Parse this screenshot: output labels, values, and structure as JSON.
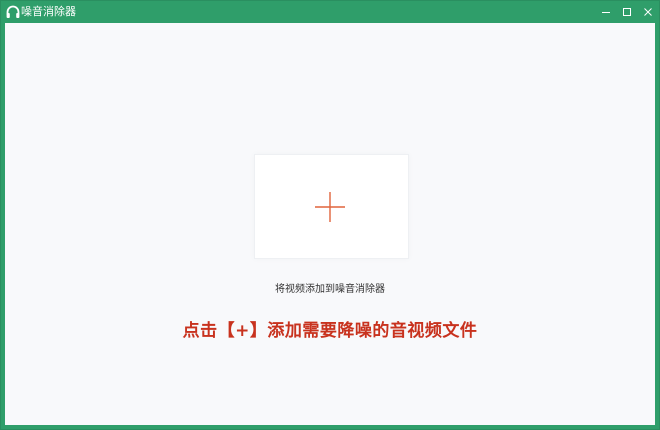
{
  "window": {
    "title": "噪音消除器",
    "accent_color": "#2f9e6a",
    "controls": {
      "minimize_icon": "minimize-icon",
      "maximize_icon": "maximize-icon",
      "close_icon": "close-icon"
    }
  },
  "main": {
    "add_icon": "plus-icon",
    "add_icon_color": "#e0643c",
    "hint": "将视频添加到噪音消除器",
    "instruction": "点击【+】添加需要降噪的音视频文件",
    "instruction_color": "#c8321e"
  }
}
